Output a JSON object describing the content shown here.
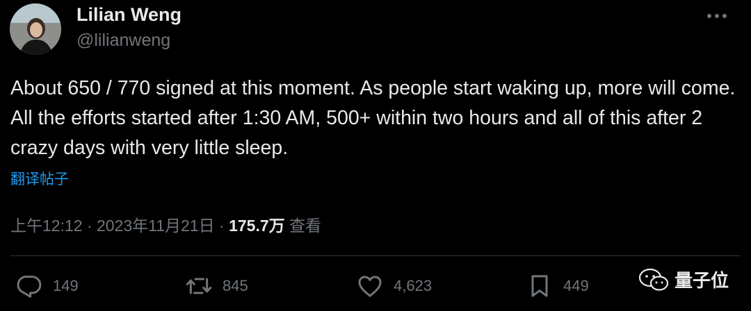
{
  "author": {
    "name": "Lilian Weng",
    "handle": "@lilianweng"
  },
  "tweet": {
    "text": "About 650 / 770 signed at this moment. As people start waking up, more will come. All the efforts started after 1:30 AM, 500+ within two hours and all of this after 2 crazy days with very little sleep.",
    "translate_label": "翻译帖子"
  },
  "meta": {
    "time": "上午12:12",
    "separator": "·",
    "date": "2023年11月21日",
    "views_count": "175.7万",
    "views_label": "查看"
  },
  "actions": {
    "replies": "149",
    "retweets": "845",
    "likes": "4,623",
    "bookmarks": "449"
  },
  "watermark": {
    "text": "量子位"
  },
  "icons": {
    "more": "more-horizontal-icon",
    "reply": "reply-icon",
    "retweet": "retweet-icon",
    "like": "heart-icon",
    "bookmark": "bookmark-icon",
    "watermark_logo": "wechat-logo-icon"
  },
  "colors": {
    "background": "#000000",
    "text_primary": "#e7e9ea",
    "text_secondary": "#71767b",
    "link": "#1d9bf0",
    "divider": "#2f3336"
  }
}
